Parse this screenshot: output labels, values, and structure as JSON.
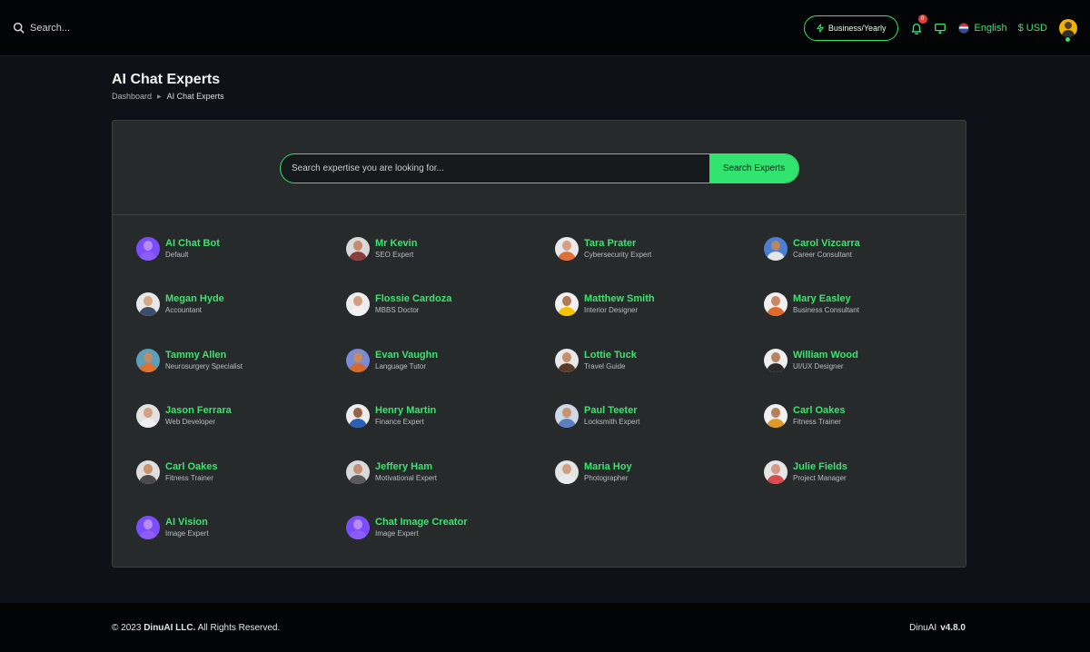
{
  "topbar": {
    "search_label": "Search...",
    "plan_label": "Business/Yearly",
    "notification_count": "0",
    "language": "English",
    "currency": "$ USD"
  },
  "page": {
    "title": "AI Chat Experts",
    "breadcrumb": [
      "Dashboard",
      "AI Chat Experts"
    ]
  },
  "search": {
    "placeholder": "Search expertise you are looking for...",
    "button_label": "Search Experts"
  },
  "experts": [
    {
      "name": "AI Chat Bot",
      "role": "Default",
      "skin": "#b88cf0",
      "shirt": "#8b5cf6",
      "bg": "#7c4dff"
    },
    {
      "name": "Mr Kevin",
      "role": "SEO Expert",
      "skin": "#c98a6b",
      "shirt": "#8a3d3d",
      "bg": "#d9d9d9"
    },
    {
      "name": "Tara Prater",
      "role": "Cybersecurity Expert",
      "skin": "#d6a07e",
      "shirt": "#e0703a",
      "bg": "#e9e9e9"
    },
    {
      "name": "Carol Vizcarra",
      "role": "Career Consultant",
      "skin": "#b98562",
      "shirt": "#e6e6e6",
      "bg": "#4a7fd4"
    },
    {
      "name": "Megan Hyde",
      "role": "Accountant",
      "skin": "#d8a886",
      "shirt": "#3b4e6a",
      "bg": "#e8e8e8"
    },
    {
      "name": "Flossie Cardoza",
      "role": "MBBS Doctor",
      "skin": "#d2a07f",
      "shirt": "#f2f2f2",
      "bg": "#ededed"
    },
    {
      "name": "Matthew Smith",
      "role": "Interior Designer",
      "skin": "#b07a58",
      "shirt": "#f5c400",
      "bg": "#f1f1f1"
    },
    {
      "name": "Mary Easley",
      "role": "Business Consultant",
      "skin": "#c98866",
      "shirt": "#e06a2c",
      "bg": "#f0f0f0"
    },
    {
      "name": "Tammy Allen",
      "role": "Neurosurgery Specialist",
      "skin": "#c2896a",
      "shirt": "#e07030",
      "bg": "#5aa0b8"
    },
    {
      "name": "Evan Vaughn",
      "role": "Language Tutor",
      "skin": "#c98a5a",
      "shirt": "#d46a2a",
      "bg": "#7a8ad6"
    },
    {
      "name": "Lottie Tuck",
      "role": "Travel Guide",
      "skin": "#c88e6e",
      "shirt": "#5a3a2a",
      "bg": "#e8e8e8"
    },
    {
      "name": "William Wood",
      "role": "UI/UX Designer",
      "skin": "#b98262",
      "shirt": "#2a2a2a",
      "bg": "#efefef"
    },
    {
      "name": "Jason Ferrara",
      "role": "Web Developer",
      "skin": "#d4a282",
      "shirt": "#f0f0f0",
      "bg": "#e2e2e2"
    },
    {
      "name": "Henry Martin",
      "role": "Finance Expert",
      "skin": "#9a6444",
      "shirt": "#2c5fb8",
      "bg": "#ededed"
    },
    {
      "name": "Paul Teeter",
      "role": "Locksmith Expert",
      "skin": "#c9946f",
      "shirt": "#5a7fc2",
      "bg": "#cfd8e6"
    },
    {
      "name": "Carl Oakes",
      "role": "Fitness Trainer",
      "skin": "#b8805a",
      "shirt": "#e09a2a",
      "bg": "#f0f0f0"
    },
    {
      "name": "Carl Oakes",
      "role": "Fitness Trainer",
      "skin": "#c9946f",
      "shirt": "#4a4a4a",
      "bg": "#dedede"
    },
    {
      "name": "Jeffery Ham",
      "role": "Motivational Expert",
      "skin": "#c39072",
      "shirt": "#5a5a5a",
      "bg": "#d9d9d9"
    },
    {
      "name": "Maria Hoy",
      "role": "Photographer",
      "skin": "#d1a083",
      "shirt": "#eaeaea",
      "bg": "#e4e4e4"
    },
    {
      "name": "Julie Fields",
      "role": "Project Manager",
      "skin": "#d69a84",
      "shirt": "#d94a4a",
      "bg": "#e6e6e6"
    },
    {
      "name": "AI Vision",
      "role": "Image Expert",
      "skin": "#b88cf0",
      "shirt": "#8b5cf6",
      "bg": "#7c4dff"
    },
    {
      "name": "Chat Image Creator",
      "role": "Image Expert",
      "skin": "#b88cf0",
      "shirt": "#8b5cf6",
      "bg": "#7c4dff"
    }
  ],
  "footer": {
    "year_prefix": "© 2023",
    "company": "DinuAI LLC.",
    "rights": "All Rights Reserved.",
    "app_name": "DinuAI",
    "version": "v4.8.0"
  }
}
